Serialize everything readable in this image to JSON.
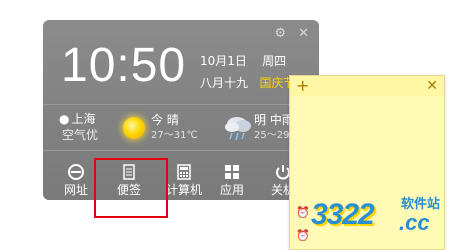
{
  "widget": {
    "time": "10:50",
    "date": "10月1日",
    "weekday": "周四",
    "lunar_date": "八月十九",
    "holiday": "国庆节",
    "location": {
      "city": "上海",
      "air_quality": "空气优"
    },
    "weather_today": {
      "day": "今",
      "condition": "晴",
      "temperature": "27～31℃"
    },
    "weather_tomorrow": {
      "day": "明",
      "condition": "中雨",
      "temperature": "25～29"
    },
    "apps": [
      {
        "label": "网址",
        "icon": "ie-icon"
      },
      {
        "label": "便签",
        "icon": "note-icon"
      },
      {
        "label": "计算机",
        "icon": "calculator-icon"
      },
      {
        "label": "应用",
        "icon": "apps-grid-icon"
      },
      {
        "label": "关机",
        "icon": "power-icon"
      }
    ]
  },
  "sticky_note": {
    "add_symbol": "+",
    "close_symbol": "✕"
  },
  "watermark": {
    "digits": "3322",
    "domain": ".cc",
    "site_name": "软件站"
  },
  "colors": {
    "widget_bg": "#7f7f7f",
    "holiday_text": "#ffd700",
    "note_bg": "#fff9b6",
    "highlight_box": "#e60012",
    "logo_blue": "#2a8fd0"
  }
}
